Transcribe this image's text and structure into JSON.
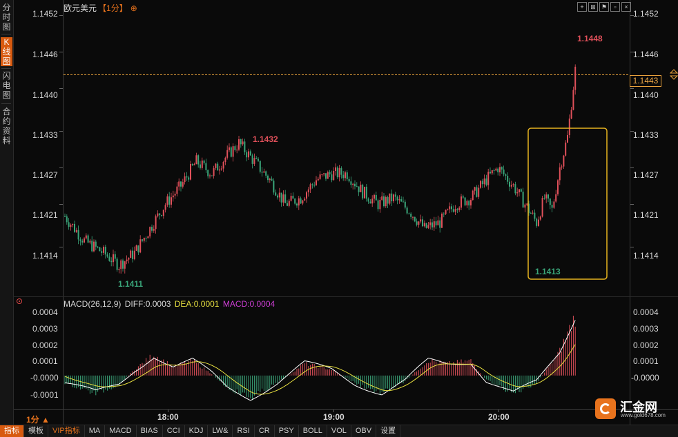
{
  "sidebar": {
    "items": [
      {
        "label": "分时图",
        "active": false
      },
      {
        "label": "K线图",
        "active": true
      },
      {
        "label": "闪电图",
        "active": false
      },
      {
        "label": "合约资料",
        "active": false
      }
    ]
  },
  "chart": {
    "instrument": "欧元美元",
    "period": "【1分】",
    "price_axis": [
      "1.1452",
      "1.1446",
      "1.1440",
      "1.1433",
      "1.1427",
      "1.1421",
      "1.1414"
    ],
    "current_price": "1.1443",
    "high_label": "1.1448",
    "low_label": "1.1411",
    "mid_high_label": "1.1432",
    "recent_low_label": "1.1413"
  },
  "macd": {
    "name": "MACD(26,12,9)",
    "diff": "DIFF:0.0003",
    "dea": "DEA:0.0001",
    "macd": "MACD:0.0004",
    "axis": [
      "0.0004",
      "0.0003",
      "0.0002",
      "0.0001",
      "-0.0000",
      "-0.0001"
    ]
  },
  "time_axis": [
    "18:00",
    "19:00",
    "20:00"
  ],
  "period_selector": "1分",
  "tabs": [
    "指标",
    "模板",
    "VIP指标",
    "MA",
    "MACD",
    "BIAS",
    "CCI",
    "KDJ",
    "LW&",
    "RSI",
    "CR",
    "PSY",
    "BOLL",
    "VOL",
    "OBV",
    "设置"
  ],
  "logo": {
    "text": "汇金网",
    "url": "www.gold678.com"
  },
  "colors": {
    "up": "#e0505a",
    "down": "#3aa67a",
    "accent": "#e8731d",
    "highlight_box": "#e8b420",
    "diff": "#ffffff",
    "dea": "#e8e040",
    "macd": "#cf3fd6"
  },
  "chart_data": {
    "type": "candlestick",
    "price_range": [
      1.1407,
      1.1453
    ],
    "macd_range": [
      -0.00015,
      0.0004
    ],
    "anchors": [
      [
        0,
        1.1419
      ],
      [
        10,
        1.1415
      ],
      [
        20,
        1.1413
      ],
      [
        28,
        1.1411
      ],
      [
        36,
        1.1413
      ],
      [
        44,
        1.1417
      ],
      [
        52,
        1.1421
      ],
      [
        60,
        1.1424
      ],
      [
        68,
        1.1428
      ],
      [
        76,
        1.1426
      ],
      [
        84,
        1.1429
      ],
      [
        90,
        1.1431
      ],
      [
        98,
        1.1428
      ],
      [
        106,
        1.1425
      ],
      [
        114,
        1.1421
      ],
      [
        122,
        1.1422
      ],
      [
        130,
        1.1425
      ],
      [
        138,
        1.1426
      ],
      [
        146,
        1.1426
      ],
      [
        154,
        1.1423
      ],
      [
        162,
        1.1421
      ],
      [
        170,
        1.1422
      ],
      [
        178,
        1.142
      ],
      [
        186,
        1.1417
      ],
      [
        194,
        1.1418
      ],
      [
        202,
        1.1421
      ],
      [
        210,
        1.1422
      ],
      [
        218,
        1.1425
      ],
      [
        224,
        1.1427
      ],
      [
        232,
        1.1424
      ],
      [
        238,
        1.1421
      ],
      [
        244,
        1.1418
      ],
      [
        248,
        1.1422
      ],
      [
        252,
        1.142
      ],
      [
        256,
        1.1427
      ],
      [
        260,
        1.1432
      ],
      [
        264,
        1.1443
      ]
    ],
    "macd_hist": [
      [
        0,
        -5e-05
      ],
      [
        16,
        -0.00012
      ],
      [
        28,
        -6e-05
      ],
      [
        36,
        4e-05
      ],
      [
        46,
        0.00014
      ],
      [
        56,
        6e-05
      ],
      [
        66,
        0.0001
      ],
      [
        76,
        1e-05
      ],
      [
        84,
        -8e-05
      ],
      [
        96,
        -0.00015
      ],
      [
        110,
        -5e-05
      ],
      [
        124,
        8e-05
      ],
      [
        138,
        4e-05
      ],
      [
        150,
        -5e-05
      ],
      [
        164,
        -0.00012
      ],
      [
        176,
        -4e-05
      ],
      [
        188,
        0.0001
      ],
      [
        198,
        8e-05
      ],
      [
        210,
        0.0001
      ],
      [
        218,
        -3e-05
      ],
      [
        232,
        -0.00012
      ],
      [
        244,
        -5e-05
      ],
      [
        256,
        0.00016
      ],
      [
        264,
        0.0004
      ]
    ]
  }
}
